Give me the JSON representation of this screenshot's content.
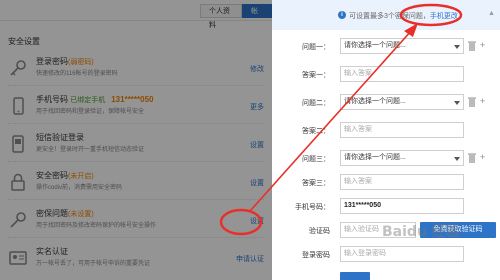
{
  "left": {
    "tabs": [
      "个人资料",
      "帐号"
    ],
    "section_title": "安全设置",
    "items": [
      {
        "icon": "key-icon",
        "title": "登录密码",
        "status": "(弱密码)",
        "status_color": "orange",
        "value": "",
        "desc": "快速修改的116帐号的登录密码",
        "action": "修改"
      },
      {
        "icon": "mobile-phone-icon",
        "title": "手机号码",
        "status": "已绑定手机",
        "status_color": "green",
        "value": "131*****050",
        "desc": "用于找回密码和登录验证，保障帐号安全",
        "action": "更多"
      },
      {
        "icon": "sms-icon",
        "title": "短信验证登录",
        "status": "",
        "status_color": "",
        "value": "",
        "desc": "更安全！登录时开一重手机短信动态验证",
        "action": "设置"
      },
      {
        "icon": "lock-icon",
        "title": "安全密码",
        "status": "(未开启)",
        "status_color": "orange",
        "value": "",
        "desc": "操作codiv前，消费需用安全密码",
        "action": "设置"
      },
      {
        "icon": "question-key-icon",
        "title": "密保问题",
        "status": "(未设置)",
        "status_color": "orange",
        "value": "",
        "desc": "用于找回密码及修改密码保护的帐号安全操作",
        "action": "设置"
      },
      {
        "icon": "id-card-icon",
        "title": "实名认证",
        "status": "",
        "status_color": "",
        "value": "",
        "desc": "万一帐号丢了，可用于帐号申诉的重要凭证",
        "action": "申请认证"
      }
    ]
  },
  "right": {
    "banner": {
      "text": "可设置最多3个密保问题，",
      "link": "手机更改"
    },
    "questions": [
      {
        "q_label": "问题一：",
        "q_placeholder": "请你选择一个问题...",
        "a_label": "答案一：",
        "a_placeholder": "输入答案"
      },
      {
        "q_label": "问题二：",
        "q_placeholder": "请你选择一个问题...",
        "a_label": "答案二：",
        "a_placeholder": "输入答案"
      },
      {
        "q_label": "问题三：",
        "q_placeholder": "请你选择一个问题...",
        "a_label": "答案三：",
        "a_placeholder": "输入答案"
      }
    ],
    "phone_label": "手机号码：",
    "phone_value": "131*****050",
    "code_label": "验证码",
    "code_placeholder": "输入验证码",
    "sms_button": "免费获取验证码",
    "password_label": "登录密码",
    "password_placeholder": "输入登录密码"
  },
  "watermark": "Baidu 经验",
  "colors": {
    "accent": "#2d73c7",
    "warning": "#f08300",
    "success": "#4a9c2d",
    "annotation": "#e8302a"
  }
}
